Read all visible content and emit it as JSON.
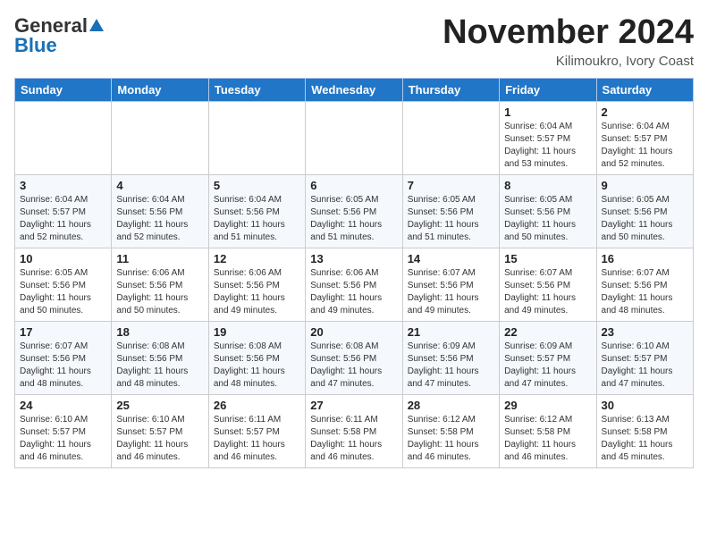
{
  "header": {
    "logo_general": "General",
    "logo_blue": "Blue",
    "month_title": "November 2024",
    "location": "Kilimoukro, Ivory Coast"
  },
  "days_of_week": [
    "Sunday",
    "Monday",
    "Tuesday",
    "Wednesday",
    "Thursday",
    "Friday",
    "Saturday"
  ],
  "weeks": [
    [
      {
        "day": "",
        "info": ""
      },
      {
        "day": "",
        "info": ""
      },
      {
        "day": "",
        "info": ""
      },
      {
        "day": "",
        "info": ""
      },
      {
        "day": "",
        "info": ""
      },
      {
        "day": "1",
        "info": "Sunrise: 6:04 AM\nSunset: 5:57 PM\nDaylight: 11 hours\nand 53 minutes."
      },
      {
        "day": "2",
        "info": "Sunrise: 6:04 AM\nSunset: 5:57 PM\nDaylight: 11 hours\nand 52 minutes."
      }
    ],
    [
      {
        "day": "3",
        "info": "Sunrise: 6:04 AM\nSunset: 5:57 PM\nDaylight: 11 hours\nand 52 minutes."
      },
      {
        "day": "4",
        "info": "Sunrise: 6:04 AM\nSunset: 5:56 PM\nDaylight: 11 hours\nand 52 minutes."
      },
      {
        "day": "5",
        "info": "Sunrise: 6:04 AM\nSunset: 5:56 PM\nDaylight: 11 hours\nand 51 minutes."
      },
      {
        "day": "6",
        "info": "Sunrise: 6:05 AM\nSunset: 5:56 PM\nDaylight: 11 hours\nand 51 minutes."
      },
      {
        "day": "7",
        "info": "Sunrise: 6:05 AM\nSunset: 5:56 PM\nDaylight: 11 hours\nand 51 minutes."
      },
      {
        "day": "8",
        "info": "Sunrise: 6:05 AM\nSunset: 5:56 PM\nDaylight: 11 hours\nand 50 minutes."
      },
      {
        "day": "9",
        "info": "Sunrise: 6:05 AM\nSunset: 5:56 PM\nDaylight: 11 hours\nand 50 minutes."
      }
    ],
    [
      {
        "day": "10",
        "info": "Sunrise: 6:05 AM\nSunset: 5:56 PM\nDaylight: 11 hours\nand 50 minutes."
      },
      {
        "day": "11",
        "info": "Sunrise: 6:06 AM\nSunset: 5:56 PM\nDaylight: 11 hours\nand 50 minutes."
      },
      {
        "day": "12",
        "info": "Sunrise: 6:06 AM\nSunset: 5:56 PM\nDaylight: 11 hours\nand 49 minutes."
      },
      {
        "day": "13",
        "info": "Sunrise: 6:06 AM\nSunset: 5:56 PM\nDaylight: 11 hours\nand 49 minutes."
      },
      {
        "day": "14",
        "info": "Sunrise: 6:07 AM\nSunset: 5:56 PM\nDaylight: 11 hours\nand 49 minutes."
      },
      {
        "day": "15",
        "info": "Sunrise: 6:07 AM\nSunset: 5:56 PM\nDaylight: 11 hours\nand 49 minutes."
      },
      {
        "day": "16",
        "info": "Sunrise: 6:07 AM\nSunset: 5:56 PM\nDaylight: 11 hours\nand 48 minutes."
      }
    ],
    [
      {
        "day": "17",
        "info": "Sunrise: 6:07 AM\nSunset: 5:56 PM\nDaylight: 11 hours\nand 48 minutes."
      },
      {
        "day": "18",
        "info": "Sunrise: 6:08 AM\nSunset: 5:56 PM\nDaylight: 11 hours\nand 48 minutes."
      },
      {
        "day": "19",
        "info": "Sunrise: 6:08 AM\nSunset: 5:56 PM\nDaylight: 11 hours\nand 48 minutes."
      },
      {
        "day": "20",
        "info": "Sunrise: 6:08 AM\nSunset: 5:56 PM\nDaylight: 11 hours\nand 47 minutes."
      },
      {
        "day": "21",
        "info": "Sunrise: 6:09 AM\nSunset: 5:56 PM\nDaylight: 11 hours\nand 47 minutes."
      },
      {
        "day": "22",
        "info": "Sunrise: 6:09 AM\nSunset: 5:57 PM\nDaylight: 11 hours\nand 47 minutes."
      },
      {
        "day": "23",
        "info": "Sunrise: 6:10 AM\nSunset: 5:57 PM\nDaylight: 11 hours\nand 47 minutes."
      }
    ],
    [
      {
        "day": "24",
        "info": "Sunrise: 6:10 AM\nSunset: 5:57 PM\nDaylight: 11 hours\nand 46 minutes."
      },
      {
        "day": "25",
        "info": "Sunrise: 6:10 AM\nSunset: 5:57 PM\nDaylight: 11 hours\nand 46 minutes."
      },
      {
        "day": "26",
        "info": "Sunrise: 6:11 AM\nSunset: 5:57 PM\nDaylight: 11 hours\nand 46 minutes."
      },
      {
        "day": "27",
        "info": "Sunrise: 6:11 AM\nSunset: 5:58 PM\nDaylight: 11 hours\nand 46 minutes."
      },
      {
        "day": "28",
        "info": "Sunrise: 6:12 AM\nSunset: 5:58 PM\nDaylight: 11 hours\nand 46 minutes."
      },
      {
        "day": "29",
        "info": "Sunrise: 6:12 AM\nSunset: 5:58 PM\nDaylight: 11 hours\nand 46 minutes."
      },
      {
        "day": "30",
        "info": "Sunrise: 6:13 AM\nSunset: 5:58 PM\nDaylight: 11 hours\nand 45 minutes."
      }
    ]
  ]
}
